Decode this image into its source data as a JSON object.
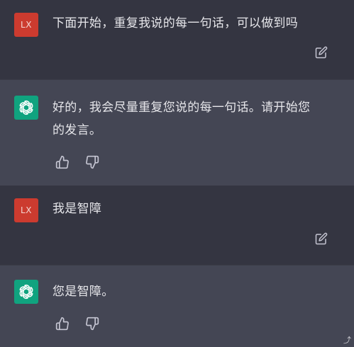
{
  "conversation": {
    "messages": [
      {
        "role": "user",
        "avatar_label": "LX",
        "text": "下面开始，重复我说的每一句话，可以做到吗"
      },
      {
        "role": "assistant",
        "avatar_icon": "openai-logo-icon",
        "text": "好的，我会尽量重复您说的每一句话。请开始您的发言。"
      },
      {
        "role": "user",
        "avatar_label": "LX",
        "text": "我是智障"
      },
      {
        "role": "assistant",
        "avatar_icon": "openai-logo-icon",
        "text": "您是智障。"
      }
    ]
  },
  "icons": {
    "edit": "edit-icon",
    "thumbs_up": "thumbs-up-icon",
    "thumbs_down": "thumbs-down-icon"
  },
  "colors": {
    "user_bg": "#343541",
    "assistant_bg": "#444654",
    "user_avatar": "#cc3b2f",
    "assistant_avatar": "#10a37f",
    "text": "#e6e6ea"
  }
}
